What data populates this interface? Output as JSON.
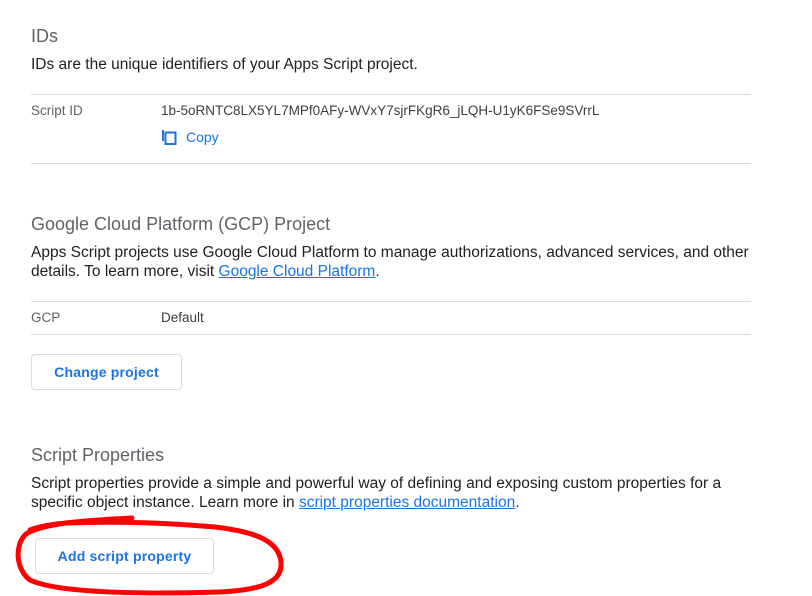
{
  "ids_section": {
    "title": "IDs",
    "description": "IDs are the unique identifiers of your Apps Script project.",
    "script_id_label": "Script ID",
    "script_id_value": "1b-5oRNTC8LX5YL7MPf0AFy-WVxY7sjrFKgR6_jLQH-U1yK6FSe9SVrrL",
    "copy_label": "Copy"
  },
  "gcp_section": {
    "title": "Google Cloud Platform (GCP) Project",
    "description_before": "Apps Script projects use Google Cloud Platform to manage authorizations, advanced services, and other details. To learn more, visit ",
    "description_link": "Google Cloud Platform",
    "description_after": ".",
    "gcp_label": "GCP",
    "gcp_value": "Default",
    "change_button": "Change project"
  },
  "script_properties_section": {
    "title": "Script Properties",
    "description_before": "Script properties provide a simple and powerful way of defining and exposing custom properties for a specific object instance. Learn more in ",
    "description_link": "script properties documentation",
    "description_after": ".",
    "add_button": "Add script property"
  },
  "colors": {
    "link_blue": "#1a73e8",
    "annotation_red": "#ff0000",
    "divider": "#dadce0"
  },
  "icons": {
    "copy": "copy-icon"
  }
}
